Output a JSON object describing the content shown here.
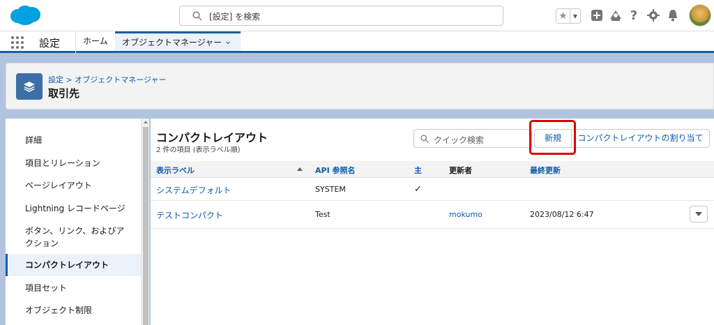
{
  "header": {
    "search_placeholder": "[設定] を検索",
    "fav_star": "★",
    "fav_dropdown": "▼"
  },
  "nav": {
    "app_name": "設定",
    "home_tab": "ホーム",
    "active_tab": "オブジェクトマネージャー",
    "active_chevron": "⌄"
  },
  "page": {
    "breadcrumb": "設定 > オブジェクトマネージャー",
    "title": "取引先"
  },
  "sidebar": {
    "items": [
      {
        "label": "詳細"
      },
      {
        "label": "項目とリレーション"
      },
      {
        "label": "ページレイアウト"
      },
      {
        "label": "Lightning レコードページ"
      },
      {
        "label": "ボタン、リンク、およびア"
      },
      {
        "label": "クション"
      },
      {
        "label": "コンパクトレイアウト"
      },
      {
        "label": "項目セット"
      },
      {
        "label": "オブジェクト制限"
      }
    ]
  },
  "main": {
    "title": "コンパクトレイアウト",
    "subtitle": "2 件の項目 (表示ラベル順)",
    "quick_search_placeholder": "クイック検索",
    "new_button": "新規",
    "assign_button": "コンパクトレイアウトの割り当て",
    "columns": [
      "表示ラベル",
      "API 参照名",
      "主",
      "更新者",
      "最終更新"
    ],
    "rows": [
      {
        "label": "システムデフォルト",
        "api": "SYSTEM",
        "primary": "✓",
        "modified_by": "",
        "last_modified": ""
      },
      {
        "label": "テストコンパクト",
        "api": "Test",
        "primary": "",
        "modified_by": "mokumo",
        "last_modified": "2023/08/12 6:47"
      }
    ]
  },
  "colors": {
    "brand_blue": "#0b5cab",
    "nav_accent": "#1b5f9e",
    "highlight_red": "#e00000",
    "background": "#b0c4df"
  }
}
